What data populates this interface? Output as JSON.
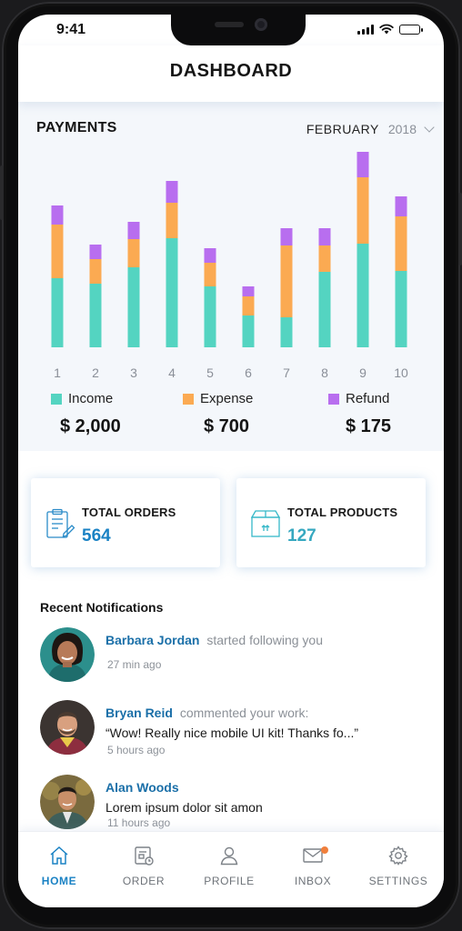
{
  "status_bar": {
    "time": "9:41",
    "icons": [
      "signal-icon",
      "wifi-icon",
      "battery-icon"
    ]
  },
  "header": {
    "title": "DASHBOARD"
  },
  "payments": {
    "title": "PAYMENTS",
    "month": "FEBRUARY",
    "year": "2018",
    "legend": [
      {
        "label": "Income",
        "amount": "$ 2,000",
        "color": "#54d4c1"
      },
      {
        "label": "Expense",
        "amount": "$ 700",
        "color": "#fbaa52"
      },
      {
        "label": "Refund",
        "amount": "$ 175",
        "color": "#b86eef"
      }
    ]
  },
  "chart_data": {
    "type": "bar",
    "stacked": true,
    "categories": [
      "1",
      "2",
      "3",
      "4",
      "5",
      "6",
      "7",
      "8",
      "9",
      "10"
    ],
    "series": [
      {
        "name": "Income",
        "color": "#54d4c1",
        "values": [
          76,
          70,
          88,
          120,
          67,
          35,
          33,
          83,
          114,
          84
        ]
      },
      {
        "name": "Expense",
        "color": "#fbaa52",
        "values": [
          59,
          27,
          31,
          39,
          26,
          21,
          79,
          29,
          73,
          60
        ]
      },
      {
        "name": "Refund",
        "color": "#b86eef",
        "values": [
          21,
          16,
          19,
          24,
          16,
          11,
          19,
          19,
          28,
          22
        ]
      }
    ],
    "title": "",
    "xlabel": "",
    "ylabel": "",
    "ylim": [
      0,
      220
    ],
    "grid": false,
    "legend_position": "bottom"
  },
  "cards": {
    "orders": {
      "title": "TOTAL ORDERS",
      "value": "564",
      "icon": "clipboard-edit-icon"
    },
    "products": {
      "title": "TOTAL PRODUCTS",
      "value": "127",
      "icon": "box-icon"
    }
  },
  "notifications": {
    "heading": "Recent Notifications",
    "items": [
      {
        "name": "Barbara Jordan",
        "action": "started following you",
        "text": "",
        "time": "27 min ago"
      },
      {
        "name": "Bryan Reid",
        "action": "commented your work:",
        "text": "“Wow! Really nice mobile UI kit! Thanks fo...”",
        "time": "5 hours ago"
      },
      {
        "name": "Alan Woods",
        "action": "",
        "text": "Lorem ipsum dolor sit amon",
        "time": "11 hours ago"
      }
    ]
  },
  "tabs": [
    {
      "label": "HOME",
      "icon": "home-icon",
      "active": true
    },
    {
      "label": "ORDER",
      "icon": "order-icon",
      "active": false
    },
    {
      "label": "PROFILE",
      "icon": "profile-icon",
      "active": false
    },
    {
      "label": "INBOX",
      "icon": "mail-icon",
      "active": false,
      "badge": true
    },
    {
      "label": "SETTINGS",
      "icon": "gear-icon",
      "active": false
    }
  ],
  "colors": {
    "accent": "#1a82c4",
    "badge": "#f07f3c",
    "income": "#54d4c1",
    "expense": "#fbaa52",
    "refund": "#b86eef"
  }
}
